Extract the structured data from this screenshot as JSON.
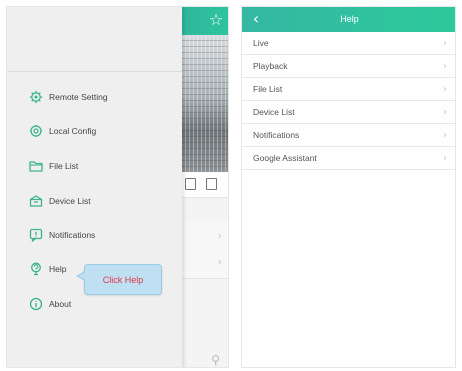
{
  "colors": {
    "header_gradient_start": "#35b7a2",
    "header_gradient_end": "#2cc99c",
    "icon_green": "#3cb488",
    "callout_background": "#bfe0f2",
    "callout_text": "#e2394a",
    "drawer_background": "#efefef"
  },
  "left_screen": {
    "header_icon": "star-outline-icon",
    "drawer": {
      "items": [
        {
          "label": "Remote Setting",
          "icon": "gear-icon"
        },
        {
          "label": "Local Config",
          "icon": "settings-cog-icon"
        },
        {
          "label": "File List",
          "icon": "folder-icon"
        },
        {
          "label": "Device List",
          "icon": "device-box-icon"
        },
        {
          "label": "Notifications",
          "icon": "notification-icon"
        },
        {
          "label": "Help",
          "icon": "help-icon"
        },
        {
          "label": "About",
          "icon": "info-icon"
        }
      ]
    },
    "callout": {
      "text": "Click Help"
    }
  },
  "right_screen": {
    "header": {
      "title": "Help",
      "back_icon": "chevron-left-icon"
    },
    "items": [
      {
        "label": "Live"
      },
      {
        "label": "Playback"
      },
      {
        "label": "File List"
      },
      {
        "label": "Device List"
      },
      {
        "label": "Notifications"
      },
      {
        "label": "Google Assistant"
      }
    ]
  }
}
